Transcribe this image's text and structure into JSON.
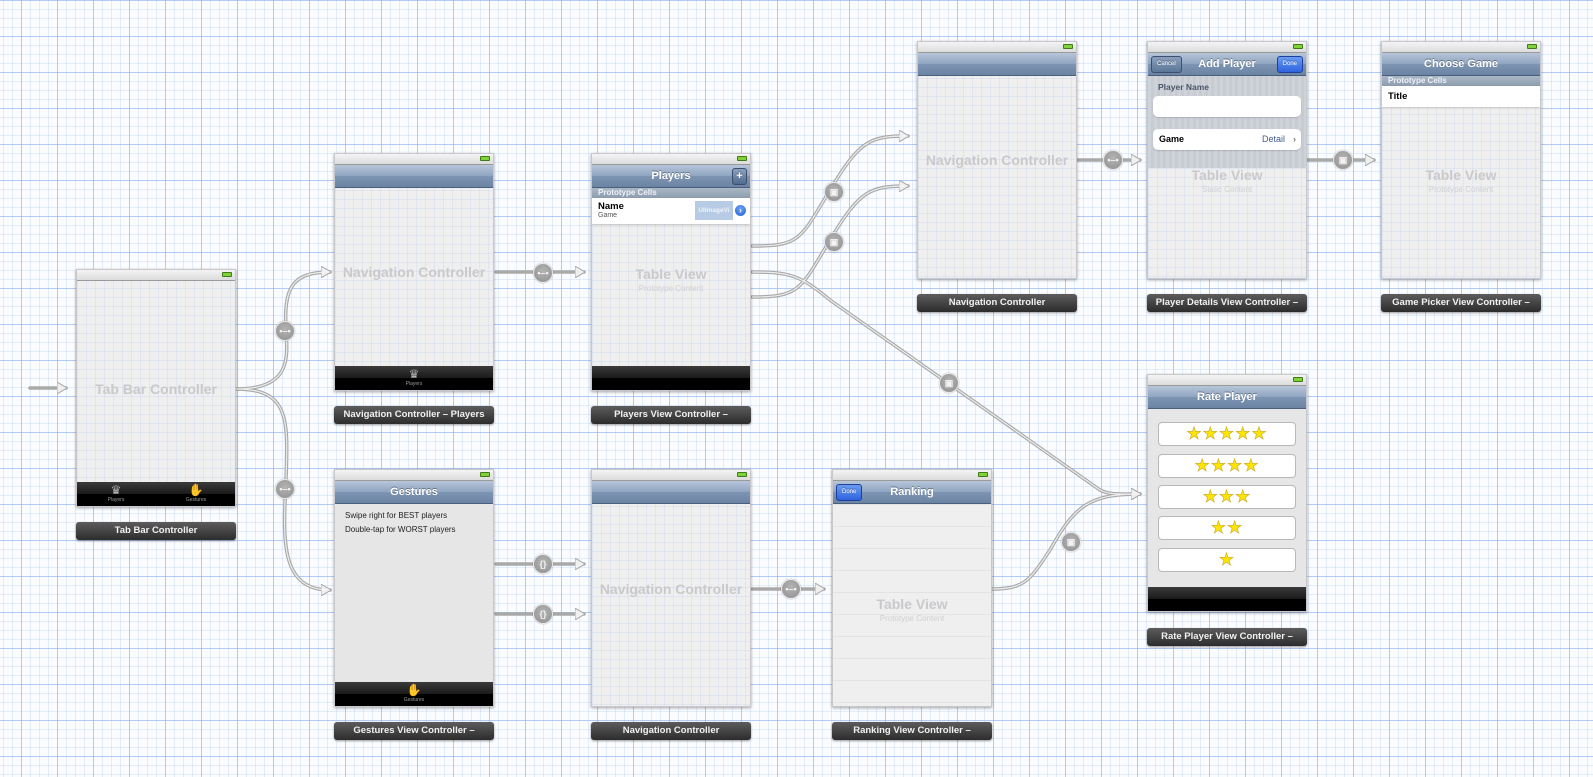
{
  "app": "Interface Builder Storyboard",
  "entry_point": "initial-view-controller-arrow",
  "scenes": {
    "tab_bar": {
      "title": "Tab Bar Controller",
      "label": "Tab Bar Controller",
      "tabs": [
        {
          "label": "Players",
          "icon": "crown-icon"
        },
        {
          "label": "Gestures",
          "icon": "hand-icon"
        }
      ]
    },
    "nav_players": {
      "title": "Navigation Controller",
      "label": "Navigation Controller – Players",
      "tab": {
        "label": "Players",
        "icon": "crown-icon"
      }
    },
    "players": {
      "nav_title": "Players",
      "add_button": "+",
      "section_header": "Prototype Cells",
      "cell": {
        "title": "Name",
        "subtitle": "Game",
        "image_placeholder": "UIImageVi",
        "accessory": "detail-disclosure"
      },
      "table_title": "Table View",
      "table_subtitle": "Prototype Content",
      "label": "Players View Controller –"
    },
    "nav_add": {
      "title": "Navigation Controller",
      "label": "Navigation Controller"
    },
    "player_details": {
      "nav_title": "Add Player",
      "cancel_button": "Cancel",
      "done_button": "Done",
      "section_header": "Player Name",
      "name_field_value": "",
      "game_cell": {
        "title": "Game",
        "detail": "Detail",
        "accessory": "›"
      },
      "table_title": "Table View",
      "table_subtitle": "Static Content",
      "label": "Player Details View Controller –"
    },
    "game_picker": {
      "nav_title": "Choose Game",
      "section_header": "Prototype Cells",
      "cell_title": "Title",
      "table_title": "Table View",
      "table_subtitle": "Prototype Content",
      "label": "Game Picker View Controller –"
    },
    "rate_player": {
      "nav_title": "Rate Player",
      "ratings": [
        {
          "stars": 5,
          "text": "★★★★★"
        },
        {
          "stars": 4,
          "text": "★★★★"
        },
        {
          "stars": 3,
          "text": "★★★"
        },
        {
          "stars": 2,
          "text": "★★"
        },
        {
          "stars": 1,
          "text": "★"
        }
      ],
      "label": "Rate Player View Controller –"
    },
    "gestures": {
      "nav_title": "Gestures",
      "lines": [
        "Swipe right for BEST players",
        "Double-tap for WORST players"
      ],
      "tab": {
        "label": "Gestures",
        "icon": "hand-icon"
      },
      "label": "Gestures View Controller –"
    },
    "nav_ranking": {
      "title": "Navigation Controller",
      "label": "Navigation Controller"
    },
    "ranking": {
      "nav_title": "Ranking",
      "done_button": "Done",
      "table_title": "Table View",
      "table_subtitle": "Prototype Content",
      "label": "Ranking View Controller –"
    }
  },
  "segues": [
    {
      "from": "tab_bar",
      "to": "nav_players",
      "type": "relationship",
      "icon": "•–•"
    },
    {
      "from": "tab_bar",
      "to": "gestures",
      "type": "relationship",
      "icon": "•–•"
    },
    {
      "from": "nav_players",
      "to": "players",
      "type": "relationship",
      "icon": "•–•"
    },
    {
      "from": "players",
      "to": "nav_add",
      "type": "modal",
      "icon": "▣"
    },
    {
      "from": "players",
      "to": "nav_add",
      "type": "modal",
      "icon": "▣"
    },
    {
      "from": "players",
      "to": "rate_player",
      "type": "modal",
      "icon": "▣"
    },
    {
      "from": "nav_add",
      "to": "player_details",
      "type": "relationship",
      "icon": "•–•"
    },
    {
      "from": "player_details",
      "to": "game_picker",
      "type": "push",
      "icon": "▣"
    },
    {
      "from": "gestures",
      "to": "nav_ranking",
      "type": "custom",
      "icon": "{}"
    },
    {
      "from": "gestures",
      "to": "nav_ranking",
      "type": "custom",
      "icon": "{}"
    },
    {
      "from": "nav_ranking",
      "to": "ranking",
      "type": "relationship",
      "icon": "•–•"
    },
    {
      "from": "ranking",
      "to": "rate_player",
      "type": "modal",
      "icon": "▣"
    }
  ],
  "colors": {
    "canvas": "#fafcff",
    "grid_major": "#8cafeb",
    "navbar": "#7d95b3",
    "done_button": "#2e63e0",
    "star_fill": "#ffe600",
    "scene_label_bg": "#2c2c2c"
  }
}
